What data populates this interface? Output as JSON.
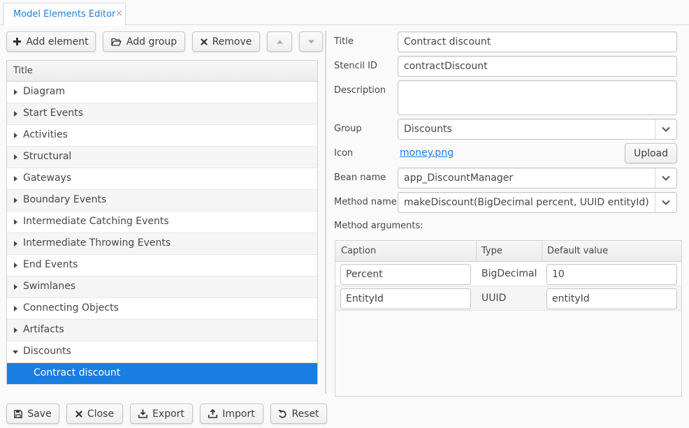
{
  "tab": {
    "title": "Model Elements Editor",
    "close": "×"
  },
  "toolbar": {
    "add_element": "Add element",
    "add_group": "Add group",
    "remove": "Remove"
  },
  "tree": {
    "header": "Title",
    "items": [
      {
        "label": "Diagram"
      },
      {
        "label": "Start Events"
      },
      {
        "label": "Activities"
      },
      {
        "label": "Structural"
      },
      {
        "label": "Gateways"
      },
      {
        "label": "Boundary Events"
      },
      {
        "label": "Intermediate Catching Events"
      },
      {
        "label": "Intermediate Throwing Events"
      },
      {
        "label": "End Events"
      },
      {
        "label": "Swimlanes"
      },
      {
        "label": "Connecting Objects"
      },
      {
        "label": "Artifacts"
      },
      {
        "label": "Discounts"
      }
    ],
    "selected_child": "Contract discount"
  },
  "form": {
    "title_label": "Title",
    "title_value": "Contract discount",
    "stencil_label": "Stencil ID",
    "stencil_value": "contractDiscount",
    "description_label": "Description",
    "description_value": "",
    "group_label": "Group",
    "group_value": "Discounts",
    "icon_label": "Icon",
    "icon_value": "money.png",
    "upload": "Upload",
    "bean_label": "Bean name",
    "bean_value": "app_DiscountManager",
    "method_label": "Method name",
    "method_value": "makeDiscount(BigDecimal percent, UUID entityId)",
    "args_label": "Method arguments:"
  },
  "args_table": {
    "headers": [
      "Caption",
      "Type",
      "Default value"
    ],
    "rows": [
      {
        "caption": "Percent",
        "type": "BigDecimal",
        "default": "10"
      },
      {
        "caption": "EntityId",
        "type": "UUID",
        "default": "entityId"
      }
    ]
  },
  "footer": {
    "save": "Save",
    "close": "Close",
    "export": "Export",
    "import": "Import",
    "reset": "Reset"
  },
  "colors": {
    "accent": "#197de1",
    "selection_text": "#ffffff"
  }
}
